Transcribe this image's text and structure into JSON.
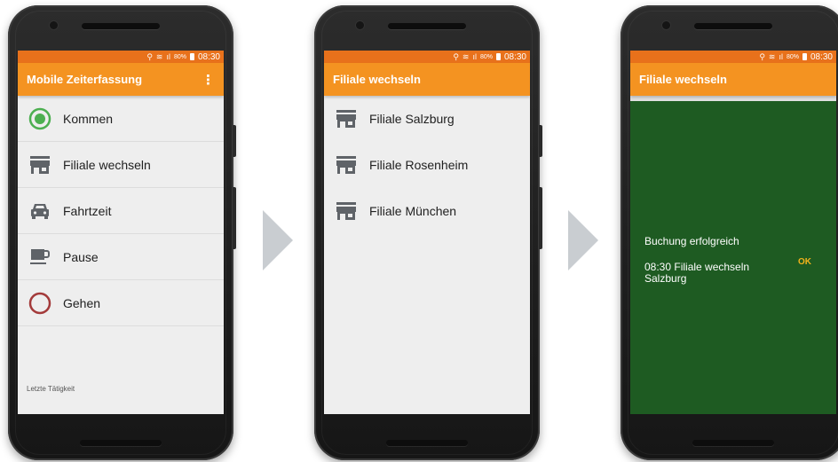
{
  "status_bar": {
    "battery": "80%",
    "time": "08:30"
  },
  "screen1": {
    "title": "Mobile Zeiterfassung",
    "menu_icon": "overflow-menu-icon",
    "items": [
      {
        "label": "Kommen",
        "icon": "check-in-circle-icon"
      },
      {
        "label": "Filiale wechseln",
        "icon": "store-icon"
      },
      {
        "label": "Fahrtzeit",
        "icon": "car-icon"
      },
      {
        "label": "Pause",
        "icon": "coffee-cup-icon"
      },
      {
        "label": "Gehen",
        "icon": "check-out-circle-icon"
      }
    ],
    "footer_label": "Letzte Tätigkeit"
  },
  "screen2": {
    "title": "Filiale wechseln",
    "items": [
      {
        "label": "Filiale Salzburg",
        "icon": "store-icon"
      },
      {
        "label": "Filiale Rosenheim",
        "icon": "store-icon"
      },
      {
        "label": "Filiale München",
        "icon": "store-icon"
      }
    ]
  },
  "screen3": {
    "title": "Filiale wechseln",
    "dialog": {
      "title": "Buchung erfolgreich",
      "message": "08:30 Filiale wechseln Salzburg",
      "ok_label": "OK"
    }
  },
  "colors": {
    "status_bar": "#e8711b",
    "app_bar": "#f49321",
    "dialog_bg": "#1e5b22",
    "ok_text": "#f2b21b",
    "kommen_green": "#4caf50",
    "gehen_red": "#a33a3a"
  }
}
